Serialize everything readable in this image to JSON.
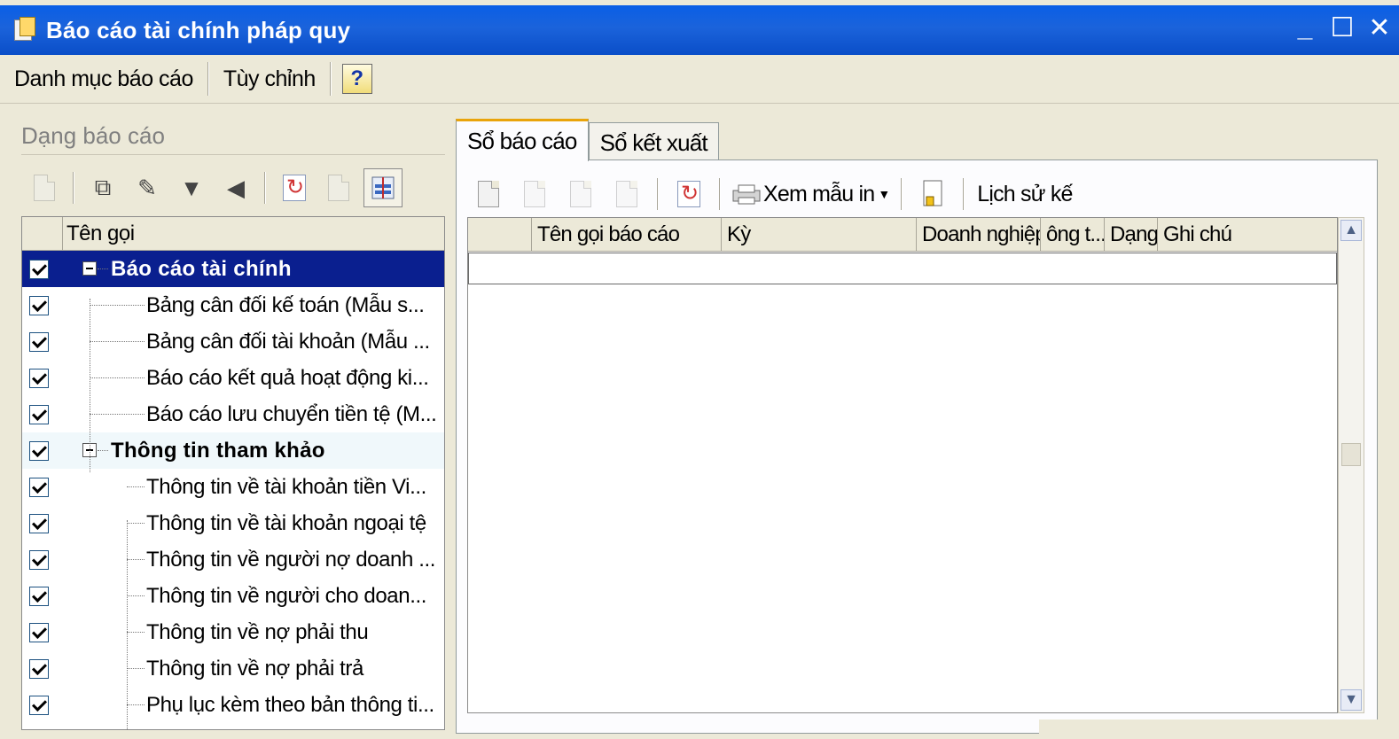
{
  "window": {
    "title": "Báo cáo tài chính pháp quy",
    "minimize": "_",
    "maximize": "☐",
    "close": "✕"
  },
  "menu": {
    "items": [
      "Danh mục báo cáo",
      "Tùy chỉnh"
    ],
    "help": "?"
  },
  "left": {
    "group_label": "Dạng báo cáo",
    "toolbar_icons": [
      "new-icon",
      "copy-icon",
      "edit-icon",
      "dropdown-arrow-icon",
      "collapse-left-icon",
      "refresh-icon",
      "properties-icon",
      "layout-icon"
    ],
    "tree_header": "Tên gọi",
    "tree": [
      {
        "text": "Báo cáo tài chính",
        "level": 0,
        "bold": true,
        "selected": true
      },
      {
        "text": "Bảng cân đối kế toán (Mẫu s...",
        "level": 1
      },
      {
        "text": "Bảng cân đối tài khoản (Mẫu ...",
        "level": 1
      },
      {
        "text": "Báo cáo kết quả hoạt động ki...",
        "level": 1
      },
      {
        "text": "Báo cáo lưu chuyển tiền tệ (M...",
        "level": 1
      },
      {
        "text": "Thông tin tham khảo",
        "level": 0,
        "bold": true,
        "highlight": true
      },
      {
        "text": "Thông tin về tài khoản tiền Vi...",
        "level": 2
      },
      {
        "text": "Thông tin về tài khoản ngoại tệ",
        "level": 2
      },
      {
        "text": "Thông tin về người nợ doanh ...",
        "level": 2
      },
      {
        "text": "Thông tin về người cho doan...",
        "level": 2
      },
      {
        "text": "Thông tin về nợ phải thu",
        "level": 2
      },
      {
        "text": "Thông tin về nợ phải trả",
        "level": 2
      },
      {
        "text": "Phụ lục kèm theo bản thông ti...",
        "level": 2
      }
    ]
  },
  "right": {
    "tabs": [
      "Sổ báo cáo",
      "Sổ kết xuất"
    ],
    "toolbar": {
      "print_preview": "Xem mẫu in",
      "history": "Lịch sử kế"
    },
    "columns": [
      "",
      "Tên gọi báo cáo",
      "Kỳ",
      "Doanh nghiệp",
      "ông t...",
      "Dạng",
      "Ghi chú"
    ]
  }
}
